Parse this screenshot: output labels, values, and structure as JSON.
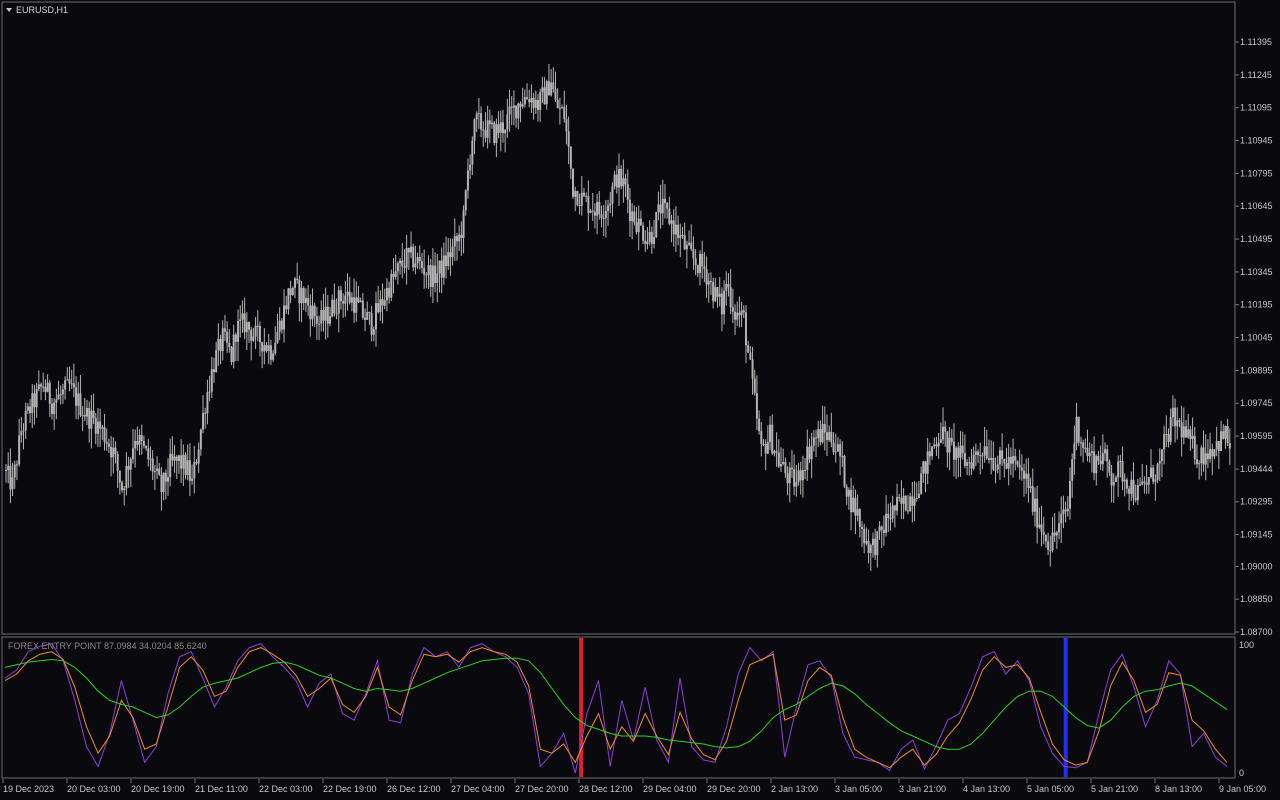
{
  "chart_data": [
    {
      "type": "candlestick",
      "title": "EURUSD,H1",
      "grid": false,
      "colors": {
        "background": "#0a0a0e",
        "candle": "#b4b4b4",
        "frame": "#7a7a7a",
        "text": "#c8c8c8"
      },
      "ylim": [
        1.087,
        1.1145
      ],
      "yticks": [
        "1.11395",
        "1.11245",
        "1.11095",
        "1.10945",
        "1.10795",
        "1.10645",
        "1.10495",
        "1.10345",
        "1.10195",
        "1.10045",
        "1.09895",
        "1.09745",
        "1.09595",
        "1.09444",
        "1.09295",
        "1.09145",
        "1.09000",
        "1.08850",
        "1.08700"
      ],
      "price_path": [
        [
          0,
          1.0944
        ],
        [
          4,
          1.0937
        ],
        [
          8,
          1.0962
        ],
        [
          12,
          1.0972
        ],
        [
          18,
          1.0983
        ],
        [
          22,
          1.0975
        ],
        [
          26,
          1.0978
        ],
        [
          30,
          1.0982
        ],
        [
          34,
          1.0975
        ],
        [
          38,
          1.0969
        ],
        [
          42,
          1.0966
        ],
        [
          46,
          1.096
        ],
        [
          50,
          1.0952
        ],
        [
          54,
          1.0936
        ],
        [
          58,
          1.0951
        ],
        [
          60,
          1.096
        ],
        [
          64,
          1.0953
        ],
        [
          68,
          1.0945
        ],
        [
          72,
          1.0935
        ],
        [
          74,
          1.094
        ],
        [
          76,
          1.0946
        ],
        [
          80,
          1.0948
        ],
        [
          84,
          1.0944
        ],
        [
          86,
          1.0938
        ],
        [
          88,
          1.095
        ],
        [
          92,
          1.0975
        ],
        [
          96,
          1.0993
        ],
        [
          100,
          1.1004
        ],
        [
          104,
          1.0996
        ],
        [
          106,
          1.1008
        ],
        [
          110,
          1.1011
        ],
        [
          114,
          1.1006
        ],
        [
          118,
          1.1003
        ],
        [
          122,
          1.0999
        ],
        [
          126,
          1.101
        ],
        [
          130,
          1.1024
        ],
        [
          132,
          1.1028
        ],
        [
          136,
          1.1024
        ],
        [
          140,
          1.1018
        ],
        [
          144,
          1.1011
        ],
        [
          148,
          1.1015
        ],
        [
          152,
          1.1021
        ],
        [
          156,
          1.1024
        ],
        [
          160,
          1.1021
        ],
        [
          164,
          1.1015
        ],
        [
          168,
          1.1011
        ],
        [
          172,
          1.1019
        ],
        [
          176,
          1.1028
        ],
        [
          180,
          1.1035
        ],
        [
          184,
          1.1041
        ],
        [
          188,
          1.104
        ],
        [
          192,
          1.1036
        ],
        [
          196,
          1.1032
        ],
        [
          200,
          1.1036
        ],
        [
          204,
          1.1043
        ],
        [
          208,
          1.105
        ],
        [
          210,
          1.1058
        ],
        [
          212,
          1.108
        ],
        [
          214,
          1.1096
        ],
        [
          216,
          1.1103
        ],
        [
          220,
          1.11
        ],
        [
          224,
          1.1098
        ],
        [
          228,
          1.1101
        ],
        [
          232,
          1.1107
        ],
        [
          236,
          1.1113
        ],
        [
          240,
          1.1115
        ],
        [
          244,
          1.1111
        ],
        [
          248,
          1.1117
        ],
        [
          250,
          1.1123
        ],
        [
          252,
          1.1111
        ],
        [
          256,
          1.1106
        ],
        [
          258,
          1.109
        ],
        [
          260,
          1.1073
        ],
        [
          264,
          1.1068
        ],
        [
          268,
          1.1065
        ],
        [
          272,
          1.1062
        ],
        [
          276,
          1.1066
        ],
        [
          280,
          1.1078
        ],
        [
          284,
          1.1073
        ],
        [
          286,
          1.1063
        ],
        [
          290,
          1.1056
        ],
        [
          294,
          1.105
        ],
        [
          296,
          1.1052
        ],
        [
          300,
          1.1064
        ],
        [
          304,
          1.1059
        ],
        [
          308,
          1.1052
        ],
        [
          312,
          1.1044
        ],
        [
          316,
          1.1039
        ],
        [
          320,
          1.1036
        ],
        [
          324,
          1.1026
        ],
        [
          328,
          1.1018
        ],
        [
          330,
          1.103
        ],
        [
          334,
          1.1016
        ],
        [
          338,
          1.1013
        ],
        [
          342,
          1.0982
        ],
        [
          346,
          1.0952
        ],
        [
          350,
          1.096
        ],
        [
          354,
          1.0948
        ],
        [
          358,
          1.0941
        ],
        [
          362,
          1.0938
        ],
        [
          366,
          1.0949
        ],
        [
          370,
          1.0958
        ],
        [
          374,
          1.0961
        ],
        [
          378,
          1.0959
        ],
        [
          382,
          1.095
        ],
        [
          386,
          1.0932
        ],
        [
          390,
          1.0924
        ],
        [
          392,
          1.0916
        ],
        [
          396,
          1.0908
        ],
        [
          400,
          1.0913
        ],
        [
          404,
          1.0923
        ],
        [
          408,
          1.0927
        ],
        [
          412,
          1.0929
        ],
        [
          416,
          1.0934
        ],
        [
          420,
          1.0943
        ],
        [
          424,
          1.0954
        ],
        [
          428,
          1.0962
        ],
        [
          432,
          1.0954
        ],
        [
          436,
          1.0951
        ],
        [
          440,
          1.0947
        ],
        [
          444,
          1.0951
        ],
        [
          448,
          1.0955
        ],
        [
          452,
          1.0949
        ],
        [
          456,
          1.0947
        ],
        [
          460,
          1.0948
        ],
        [
          464,
          1.0943
        ],
        [
          468,
          1.0938
        ],
        [
          470,
          1.0928
        ],
        [
          474,
          1.0918
        ],
        [
          478,
          1.091
        ],
        [
          482,
          1.0918
        ],
        [
          486,
          1.0927
        ],
        [
          488,
          1.095
        ],
        [
          490,
          1.0965
        ],
        [
          494,
          1.0953
        ],
        [
          498,
          1.0948
        ],
        [
          502,
          1.0951
        ],
        [
          506,
          1.0941
        ],
        [
          510,
          1.0944
        ],
        [
          514,
          1.0938
        ],
        [
          518,
          1.0933
        ],
        [
          520,
          1.0936
        ],
        [
          524,
          1.0941
        ],
        [
          528,
          1.0946
        ],
        [
          530,
          1.0955
        ],
        [
          534,
          1.0967
        ],
        [
          538,
          1.0963
        ],
        [
          542,
          1.0956
        ],
        [
          546,
          1.095
        ],
        [
          550,
          1.0953
        ],
        [
          554,
          1.0956
        ],
        [
          558,
          1.096
        ],
        [
          562,
          1.095
        ]
      ],
      "total_bars": 560
    },
    {
      "type": "line",
      "title": "FOREX ENTRY POINT 87.0984 34.0204 85.6240",
      "ylim": [
        0,
        100
      ],
      "ytick_labels": [
        "100",
        "0"
      ],
      "x_labels": [
        "19 Dec 2023",
        "20 Dec 03:00",
        "20 Dec 19:00",
        "21 Dec 11:00",
        "22 Dec 03:00",
        "22 Dec 19:00",
        "26 Dec 12:00",
        "27 Dec 04:00",
        "27 Dec 20:00",
        "28 Dec 12:00",
        "29 Dec 04:00",
        "29 Dec 20:00",
        "2 Jan 13:00",
        "3 Jan 05:00",
        "3 Jan 21:00",
        "4 Jan 13:00",
        "5 Jan 05:00",
        "5 Jan 21:00",
        "8 Jan 13:00",
        "9 Jan 05:00"
      ],
      "series": [
        {
          "color": "#8b3fe0",
          "values": [
            72,
            78,
            92,
            96,
            98,
            85,
            55,
            20,
            5,
            30,
            70,
            40,
            8,
            20,
            60,
            88,
            92,
            72,
            50,
            65,
            85,
            95,
            98,
            88,
            80,
            70,
            50,
            68,
            75,
            45,
            40,
            60,
            85,
            40,
            38,
            75,
            95,
            88,
            92,
            80,
            95,
            98,
            92,
            88,
            80,
            60,
            5,
            15,
            30,
            0,
            45,
            70,
            5,
            55,
            25,
            65,
            25,
            8,
            72,
            20,
            10,
            8,
            35,
            75,
            95,
            85,
            92,
            12,
            50,
            82,
            85,
            72,
            30,
            12,
            10,
            8,
            2,
            18,
            25,
            3,
            20,
            40,
            45,
            65,
            88,
            92,
            75,
            85,
            70,
            35,
            15,
            5,
            4,
            8,
            45,
            78,
            90,
            65,
            35,
            55,
            85,
            75,
            20,
            30,
            12,
            5
          ]
        },
        {
          "color": "#f28c1e",
          "values": [
            70,
            75,
            85,
            90,
            92,
            86,
            65,
            35,
            15,
            28,
            55,
            42,
            18,
            22,
            50,
            80,
            88,
            78,
            58,
            62,
            80,
            92,
            95,
            90,
            84,
            74,
            58,
            64,
            72,
            52,
            46,
            58,
            80,
            50,
            44,
            70,
            90,
            88,
            90,
            84,
            92,
            95,
            92,
            90,
            84,
            66,
            18,
            15,
            22,
            8,
            28,
            45,
            18,
            35,
            24,
            45,
            28,
            14,
            46,
            26,
            14,
            10,
            24,
            55,
            82,
            86,
            90,
            40,
            44,
            70,
            80,
            74,
            42,
            18,
            12,
            8,
            4,
            12,
            18,
            6,
            14,
            28,
            38,
            56,
            78,
            88,
            80,
            82,
            72,
            46,
            22,
            10,
            6,
            8,
            32,
            66,
            84,
            70,
            46,
            52,
            76,
            74,
            40,
            32,
            18,
            8
          ]
        },
        {
          "color": "#2bd21e",
          "values": [
            80,
            82,
            84,
            85,
            86,
            85,
            80,
            72,
            62,
            55,
            52,
            50,
            46,
            42,
            44,
            50,
            58,
            65,
            68,
            70,
            72,
            76,
            80,
            83,
            84,
            82,
            78,
            74,
            72,
            68,
            64,
            62,
            64,
            63,
            62,
            64,
            68,
            72,
            76,
            79,
            82,
            85,
            86,
            87,
            87,
            85,
            76,
            64,
            52,
            42,
            36,
            33,
            30,
            28,
            28,
            28,
            27,
            25,
            24,
            23,
            22,
            20,
            19,
            20,
            24,
            32,
            42,
            48,
            52,
            58,
            64,
            68,
            66,
            60,
            52,
            45,
            38,
            32,
            28,
            24,
            20,
            18,
            18,
            22,
            30,
            40,
            50,
            58,
            62,
            62,
            58,
            50,
            42,
            36,
            34,
            40,
            50,
            58,
            62,
            63,
            66,
            68,
            66,
            60,
            54,
            48
          ]
        }
      ],
      "markers": [
        {
          "color": "#e0202c",
          "position_fraction": 0.47
        },
        {
          "color": "#1e32f0",
          "position_fraction": 0.864
        }
      ]
    }
  ]
}
